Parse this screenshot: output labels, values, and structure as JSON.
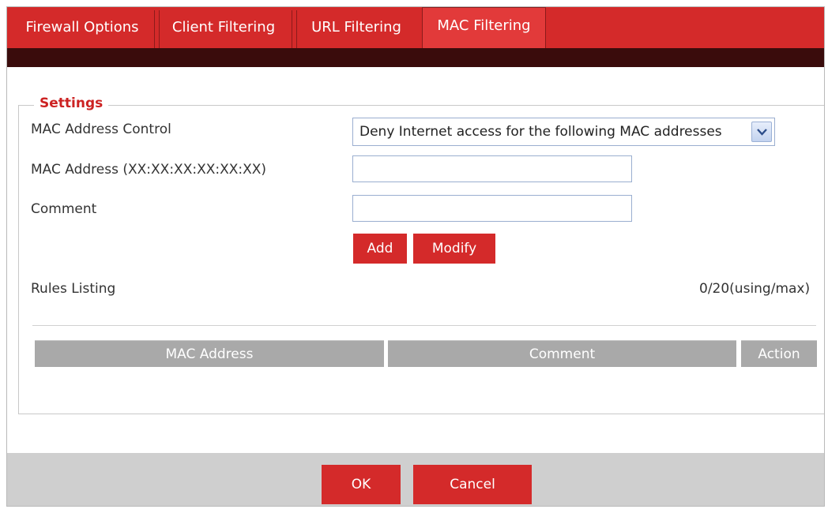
{
  "tabs": [
    {
      "label": "Firewall Options",
      "active": false
    },
    {
      "label": "Client Filtering",
      "active": false
    },
    {
      "label": "URL Filtering",
      "active": false
    },
    {
      "label": "MAC Filtering",
      "active": true
    }
  ],
  "settings": {
    "legend": "Settings",
    "mac_control_label": "MAC Address Control",
    "mac_control_value": "Deny Internet access for the following MAC addresses",
    "mac_address_label": "MAC Address (XX:XX:XX:XX:XX:XX)",
    "mac_address_value": "",
    "comment_label": "Comment",
    "comment_value": "",
    "add_label": "Add",
    "modify_label": "Modify",
    "rules_listing_label": "Rules Listing",
    "rules_count": "0/20(using/max)"
  },
  "table": {
    "headers": [
      "MAC Address",
      "Comment",
      "Action"
    ]
  },
  "footer": {
    "ok_label": "OK",
    "cancel_label": "Cancel"
  },
  "colors": {
    "accent": "#d42a2a",
    "dark_bar": "#3a0c0c",
    "header_gray": "#a9a9a9"
  }
}
